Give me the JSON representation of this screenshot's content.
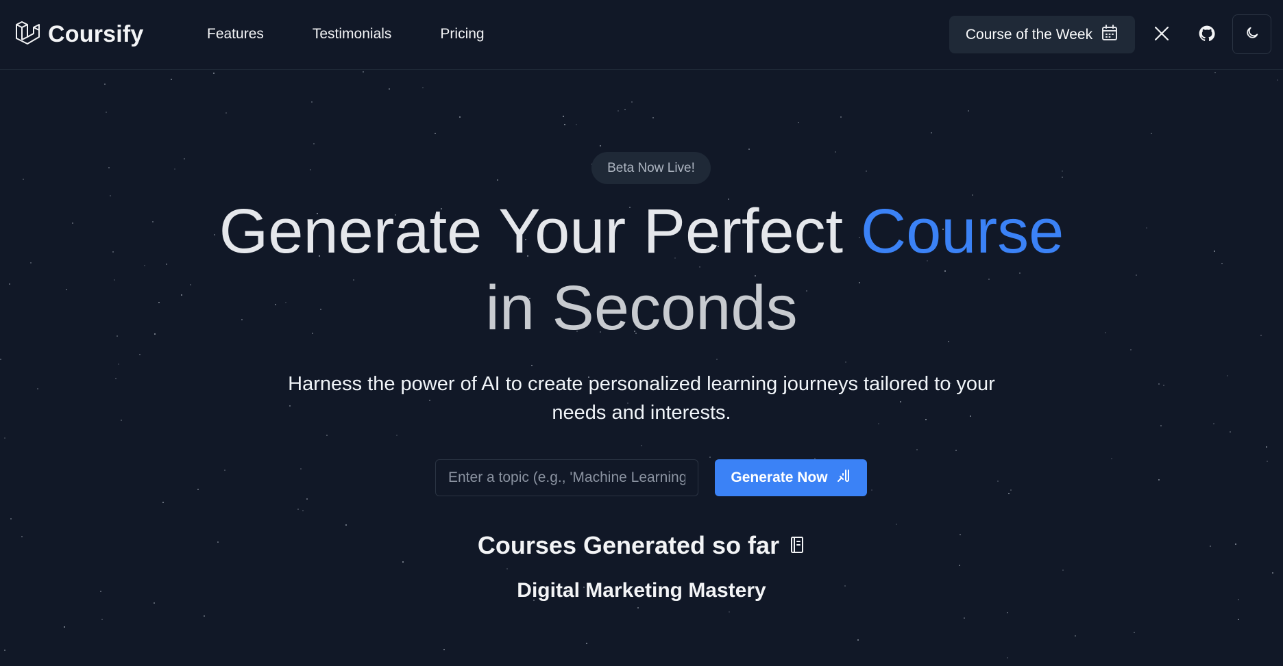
{
  "brand": {
    "name": "Coursify",
    "logo_icon": "layered-cube-logo-icon"
  },
  "nav": {
    "links": [
      {
        "label": "Features"
      },
      {
        "label": "Testimonials"
      },
      {
        "label": "Pricing"
      }
    ],
    "course_of_week": {
      "label": "Course of the Week",
      "icon": "calendar-icon"
    },
    "social": [
      {
        "icon": "x-twitter-icon"
      },
      {
        "icon": "github-icon"
      }
    ],
    "theme_toggle": {
      "icon": "moon-icon"
    }
  },
  "hero": {
    "badge": "Beta Now Live!",
    "headline_part1": "Generate Your Perfect ",
    "headline_accent": "Course",
    "headline_line2": "in Seconds",
    "subtitle": "Harness the power of AI to create personalized learning journeys tailored to your needs and interests.",
    "input": {
      "placeholder": "Enter a topic (e.g., 'Machine Learning')",
      "value": ""
    },
    "generate_button": {
      "label": "Generate Now",
      "icon": "wand-icon"
    },
    "counter_title": "Courses Generated so far",
    "counter_icon": "notebook-icon",
    "ticker_item": "Digital Marketing Mastery"
  },
  "colors": {
    "background": "#111827",
    "accent": "#3b82f6",
    "surface": "#1f2937"
  }
}
